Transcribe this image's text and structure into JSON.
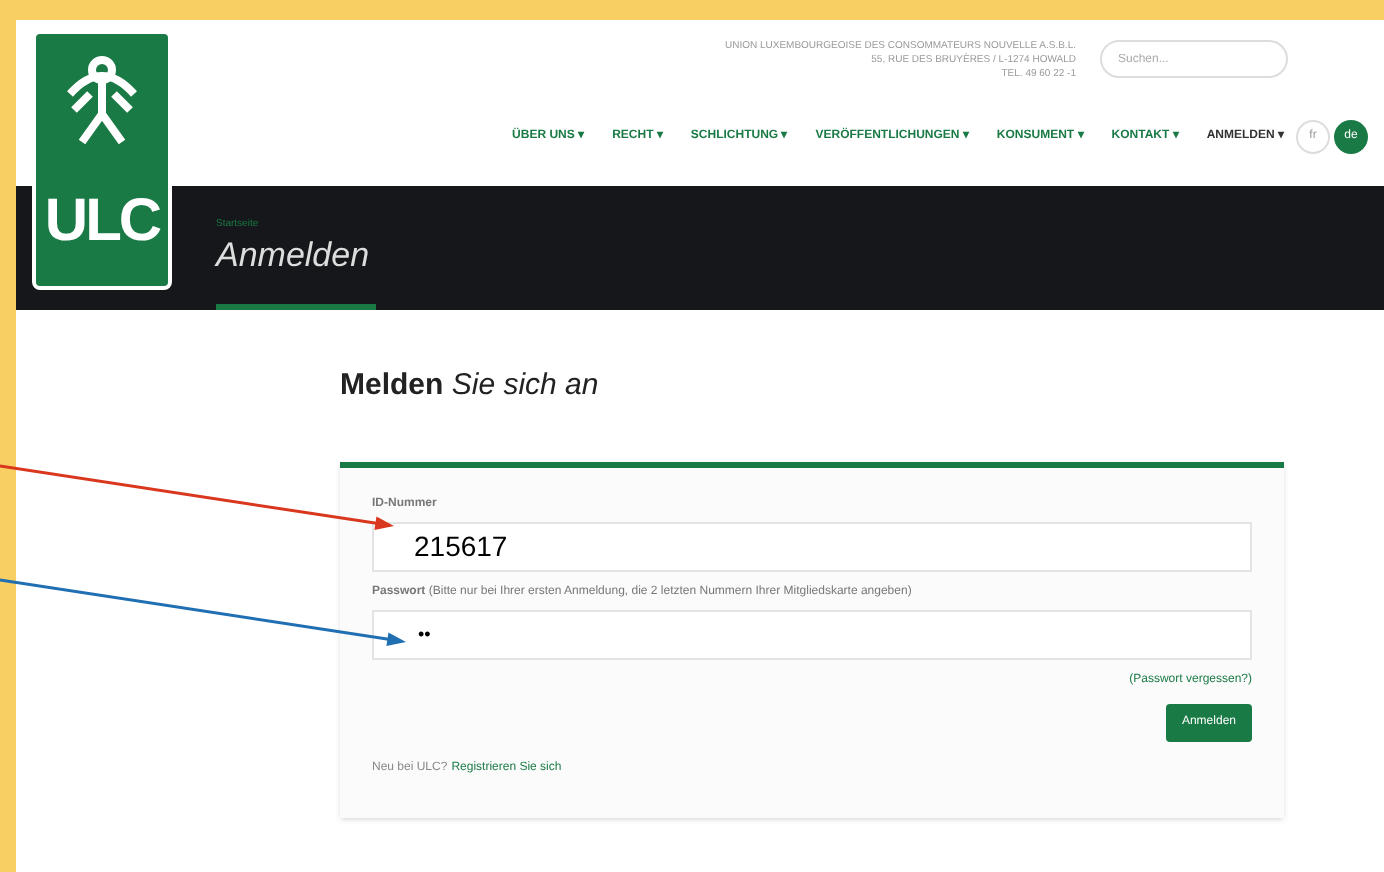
{
  "header": {
    "logo_text": "ULC",
    "address_lines": [
      "UNION LUXEMBOURGEOISE DES CONSOMMATEURS NOUVELLE A.S.B.L.",
      "55, RUE DES BRUYÈRES / L-1274 HOWALD",
      "TEL. 49 60 22 -1"
    ],
    "search": {
      "placeholder": "Suchen..."
    },
    "nav": [
      {
        "label": "ÜBER UNS ▾",
        "dark": false
      },
      {
        "label": "RECHT ▾",
        "dark": false
      },
      {
        "label": "SCHLICHTUNG ▾",
        "dark": false
      },
      {
        "label": "VERÖFFENTLICHUNGEN ▾",
        "dark": false
      },
      {
        "label": "KONSUMENT ▾",
        "dark": false
      },
      {
        "label": "KONTAKT ▾",
        "dark": false
      },
      {
        "label": "ANMELDEN ▾",
        "dark": true
      }
    ],
    "languages": [
      {
        "label": "fr",
        "selected": false
      },
      {
        "label": "de",
        "selected": true
      }
    ]
  },
  "banner": {
    "breadcrumb": "Startseite",
    "title": "Anmelden"
  },
  "heading": "**Melden** *Sie sich an*",
  "form": {
    "fields": [
      {
        "label": "**ID-Nummer**",
        "value": "215617"
      },
      {
        "label": "**Passwort** (Bitte nur bei Ihrer ersten Anmeldung, die 2 letzten Nummern Ihrer Mitgliedskarte angeben)",
        "value": "••"
      }
    ],
    "forgot_link": "(Passwort vergessen?)",
    "submit": "Anmelden",
    "register_prompt": "Neu bei ULC?",
    "register_link": "Registrieren Sie sich"
  },
  "annotations": [
    {
      "color": "#d9381e"
    },
    {
      "color": "#1f6fb2"
    }
  ]
}
